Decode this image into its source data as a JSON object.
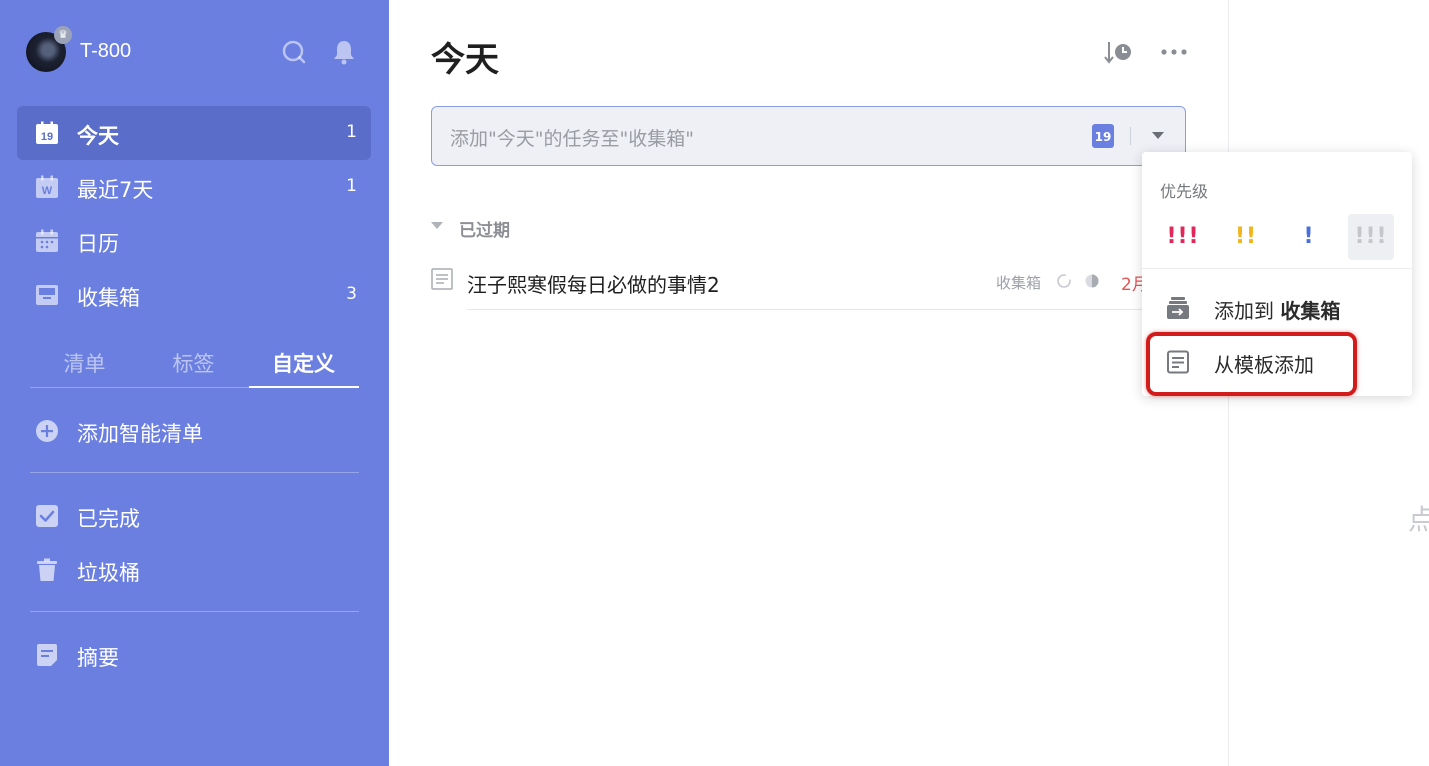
{
  "sidebar": {
    "user": {
      "name": "T-800",
      "badge_icon": "crown-icon"
    },
    "top_icons": [
      "search-icon",
      "bell-icon"
    ],
    "nav": [
      {
        "label": "今天",
        "count": "1",
        "icon": "calendar-day-icon",
        "icon_text": "19",
        "active": true
      },
      {
        "label": "最近7天",
        "count": "1",
        "icon": "calendar-week-icon",
        "icon_text": "W"
      },
      {
        "label": "日历",
        "count": "",
        "icon": "calendar-icon"
      },
      {
        "label": "收集箱",
        "count": "3",
        "icon": "inbox-icon"
      }
    ],
    "tabs": [
      "清单",
      "标签",
      "自定义"
    ],
    "active_tab": "自定义",
    "add_smart_list": "添加智能清单",
    "completed": "已完成",
    "trash": "垃圾桶",
    "summary": "摘要",
    "accent": "#6b7fe0"
  },
  "main": {
    "title": "今天",
    "add_task_placeholder": "添加\"今天\"的任务至\"收集箱\"",
    "date_badge": "19",
    "section": "已过期",
    "tasks": [
      {
        "title": "汪子熙寒假每日必做的事情2",
        "list": "收集箱",
        "date": "2月"
      }
    ],
    "right_hint": "点"
  },
  "dropdown": {
    "priority_label": "优先级",
    "priorities": [
      {
        "glyph": "!!!",
        "color": "#e2285a",
        "name": "high"
      },
      {
        "glyph": "!!",
        "color": "#f2b41b",
        "name": "medium"
      },
      {
        "glyph": "!",
        "color": "#4a6fd8",
        "name": "low"
      },
      {
        "glyph": "!!!",
        "color": "#c4c6cc",
        "name": "none",
        "selected": true
      }
    ],
    "add_to_prefix": "添加到 ",
    "add_to_target": "收集箱",
    "from_template": "从模板添加"
  }
}
